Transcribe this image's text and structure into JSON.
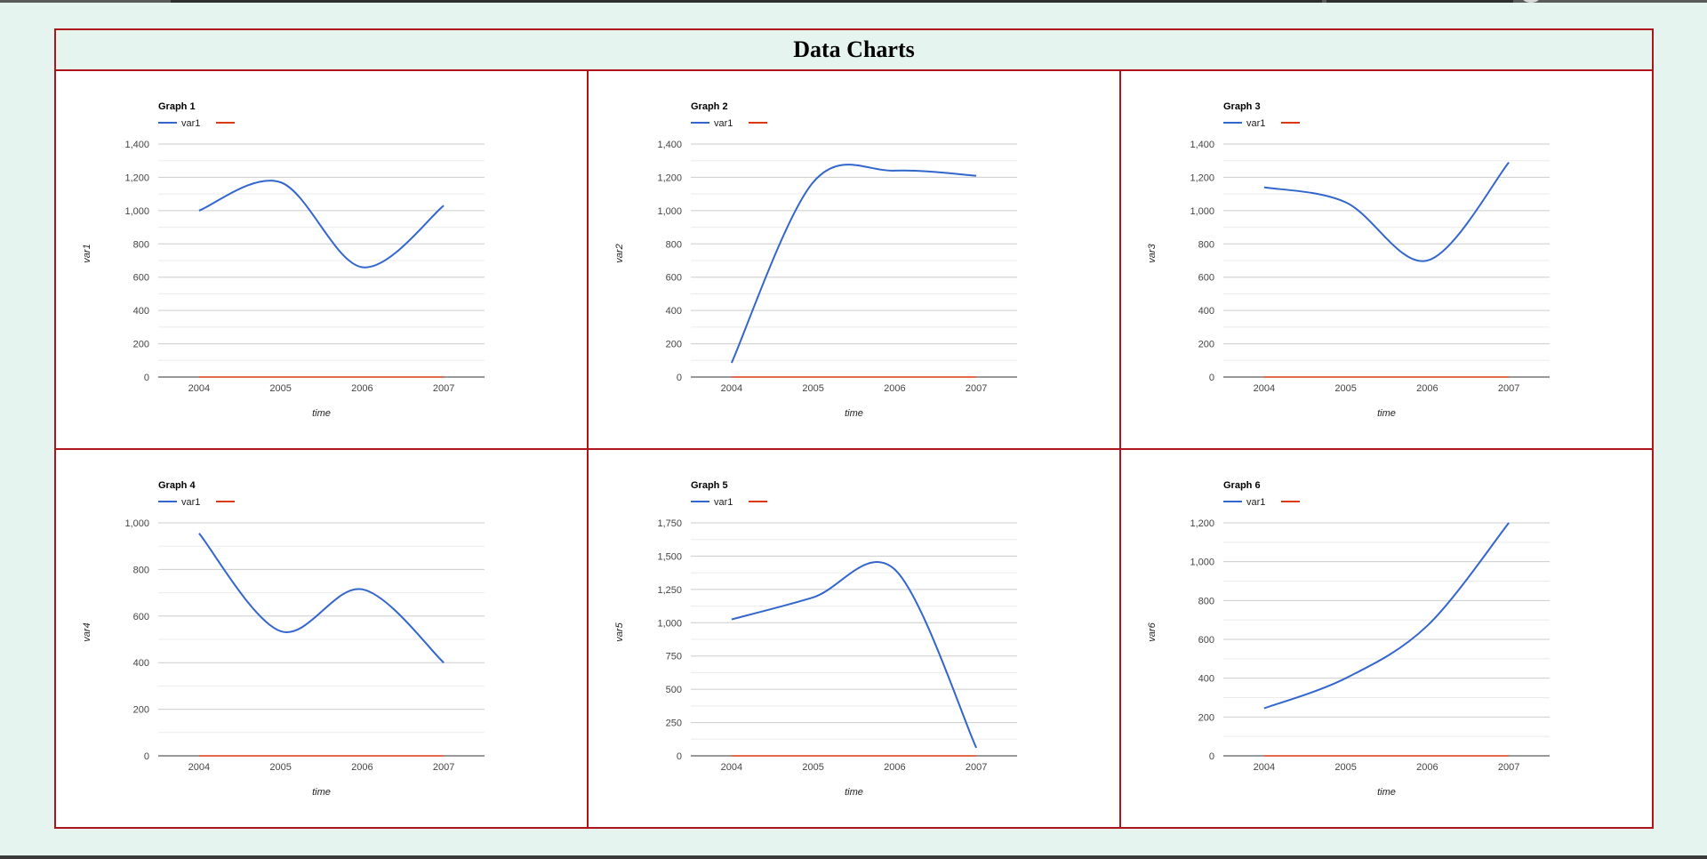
{
  "page": {
    "title": "Data Charts"
  },
  "colors": {
    "series1": "#3366cc",
    "series2": "#dc3912",
    "border": "#b0141b",
    "background": "#e6f4f0"
  },
  "chart_data": [
    {
      "type": "line",
      "title": "Graph 1",
      "xlabel": "time",
      "ylabel": "var1",
      "x": [
        "2004",
        "2005",
        "2006",
        "2007"
      ],
      "series": [
        {
          "name": "var1",
          "values": [
            1000,
            1170,
            660,
            1030
          ]
        },
        {
          "name": "",
          "values": [
            0,
            0,
            0,
            0
          ]
        }
      ],
      "ylim": [
        0,
        1400
      ],
      "yticks": [
        0,
        200,
        400,
        600,
        800,
        1000,
        1200,
        1400
      ],
      "ytick_labels": [
        "0",
        "200",
        "400",
        "600",
        "800",
        "1,000",
        "1,200",
        "1,400"
      ],
      "grid": true,
      "legend": "top-left"
    },
    {
      "type": "line",
      "title": "Graph 2",
      "xlabel": "time",
      "ylabel": "var2",
      "x": [
        "2004",
        "2005",
        "2006",
        "2007"
      ],
      "series": [
        {
          "name": "var1",
          "values": [
            85,
            1170,
            1240,
            1210
          ]
        },
        {
          "name": "",
          "values": [
            0,
            0,
            0,
            0
          ]
        }
      ],
      "ylim": [
        0,
        1400
      ],
      "yticks": [
        0,
        200,
        400,
        600,
        800,
        1000,
        1200,
        1400
      ],
      "ytick_labels": [
        "0",
        "200",
        "400",
        "600",
        "800",
        "1,000",
        "1,200",
        "1,400"
      ],
      "grid": true,
      "legend": "top-left"
    },
    {
      "type": "line",
      "title": "Graph 3",
      "xlabel": "time",
      "ylabel": "var3",
      "x": [
        "2004",
        "2005",
        "2006",
        "2007"
      ],
      "series": [
        {
          "name": "var1",
          "values": [
            1140,
            1050,
            700,
            1290
          ]
        },
        {
          "name": "",
          "values": [
            0,
            0,
            0,
            0
          ]
        }
      ],
      "ylim": [
        0,
        1400
      ],
      "yticks": [
        0,
        200,
        400,
        600,
        800,
        1000,
        1200,
        1400
      ],
      "ytick_labels": [
        "0",
        "200",
        "400",
        "600",
        "800",
        "1,000",
        "1,200",
        "1,400"
      ],
      "grid": true,
      "legend": "top-left"
    },
    {
      "type": "line",
      "title": "Graph 4",
      "xlabel": "time",
      "ylabel": "var4",
      "x": [
        "2004",
        "2005",
        "2006",
        "2007"
      ],
      "series": [
        {
          "name": "var1",
          "values": [
            955,
            535,
            715,
            400
          ]
        },
        {
          "name": "",
          "values": [
            0,
            0,
            0,
            0
          ]
        }
      ],
      "ylim": [
        0,
        1000
      ],
      "yticks": [
        0,
        200,
        400,
        600,
        800,
        1000
      ],
      "ytick_labels": [
        "0",
        "200",
        "400",
        "600",
        "800",
        "1,000"
      ],
      "grid": true,
      "legend": "top-left"
    },
    {
      "type": "line",
      "title": "Graph 5",
      "xlabel": "time",
      "ylabel": "var5",
      "x": [
        "2004",
        "2005",
        "2006",
        "2007"
      ],
      "series": [
        {
          "name": "var1",
          "values": [
            1025,
            1190,
            1400,
            60
          ]
        },
        {
          "name": "",
          "values": [
            0,
            0,
            0,
            0
          ]
        }
      ],
      "ylim": [
        0,
        1750
      ],
      "yticks": [
        0,
        250,
        500,
        750,
        1000,
        1250,
        1500,
        1750
      ],
      "ytick_labels": [
        "0",
        "250",
        "500",
        "750",
        "1,000",
        "1,250",
        "1,500",
        "1,750"
      ],
      "grid": true,
      "legend": "top-left"
    },
    {
      "type": "line",
      "title": "Graph 6",
      "xlabel": "time",
      "ylabel": "var6",
      "x": [
        "2004",
        "2005",
        "2006",
        "2007"
      ],
      "series": [
        {
          "name": "var1",
          "values": [
            245,
            400,
            670,
            1200
          ]
        },
        {
          "name": "",
          "values": [
            0,
            0,
            0,
            0
          ]
        }
      ],
      "ylim": [
        0,
        1200
      ],
      "yticks": [
        0,
        200,
        400,
        600,
        800,
        1000,
        1200
      ],
      "ytick_labels": [
        "0",
        "200",
        "400",
        "600",
        "800",
        "1,000",
        "1,200"
      ],
      "grid": true,
      "legend": "top-left"
    }
  ]
}
